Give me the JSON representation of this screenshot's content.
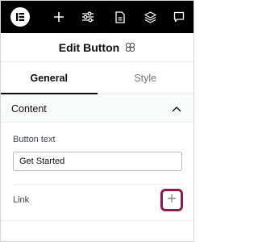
{
  "toolbar": {
    "items": [
      {
        "icon": "elementor-logo-icon"
      },
      {
        "icon": "plus-icon"
      },
      {
        "icon": "sliders-icon"
      },
      {
        "icon": "page-icon"
      },
      {
        "icon": "layers-icon"
      },
      {
        "icon": "comment-icon"
      }
    ]
  },
  "header": {
    "title": "Edit Button",
    "icon": "ai-sparkle-icon"
  },
  "tabs": [
    {
      "label": "General",
      "active": true
    },
    {
      "label": "Style",
      "active": false
    }
  ],
  "section": {
    "title": "Content",
    "expanded": true,
    "icon": "chevron-up-icon"
  },
  "fields": {
    "button_text_label": "Button text",
    "button_text_value": "Get Started",
    "link_label": "Link",
    "link_add_icon": "plus-icon"
  },
  "colors": {
    "toolbar_bg": "#000000",
    "highlight": "#8e1b4f"
  }
}
